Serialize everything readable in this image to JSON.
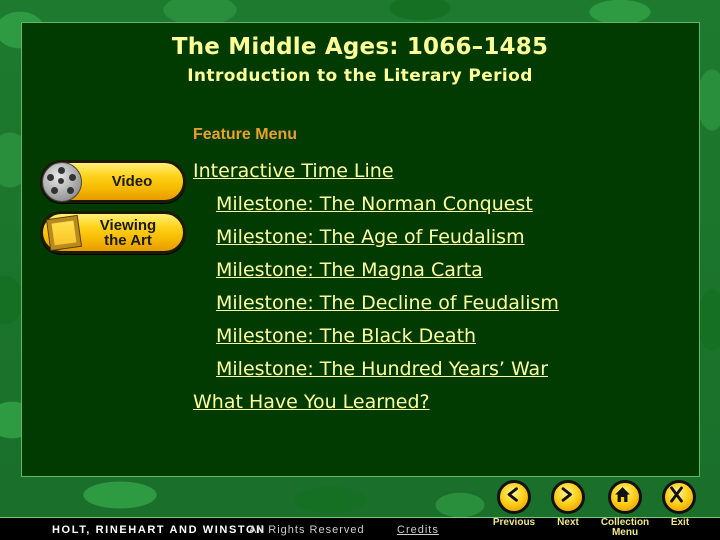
{
  "header": {
    "title": "The Middle Ages: 1066–1485",
    "subtitle": "Introduction to the Literary Period"
  },
  "feature_menu": {
    "heading": "Feature Menu",
    "buttons": [
      {
        "label": "Video",
        "icon": "film-reel-icon"
      },
      {
        "label": "Viewing the Art",
        "icon": "picture-frame-icon"
      }
    ],
    "links": [
      {
        "label": "Interactive Time Line",
        "indent": false
      },
      {
        "label": "Milestone: The Norman Conquest",
        "indent": true
      },
      {
        "label": "Milestone: The Age of Feudalism",
        "indent": true
      },
      {
        "label": "Milestone: The Magna Carta",
        "indent": true
      },
      {
        "label": "Milestone: The Decline of Feudalism",
        "indent": true
      },
      {
        "label": "Milestone: The Black Death",
        "indent": true
      },
      {
        "label": "Milestone: The Hundred Years’ War",
        "indent": true
      },
      {
        "label": "What Have You Learned?",
        "indent": false
      }
    ]
  },
  "footer": {
    "publisher": "HOLT, RINEHART AND WINSTON",
    "rights": "All Rights Reserved",
    "credits": "Credits"
  },
  "nav": [
    {
      "label": "Previous",
      "icon": "chevron-left-icon"
    },
    {
      "label": "Next",
      "icon": "chevron-right-icon"
    },
    {
      "label": "Collection Menu",
      "icon": "home-icon"
    },
    {
      "label": "Exit",
      "icon": "close-icon"
    }
  ],
  "colors": {
    "panel_bg": "#023b02",
    "title_text": "#ffff99",
    "feature_heading": "#e8a030",
    "link_text": "#ffffa0",
    "button_gold": "#ffd21a"
  }
}
